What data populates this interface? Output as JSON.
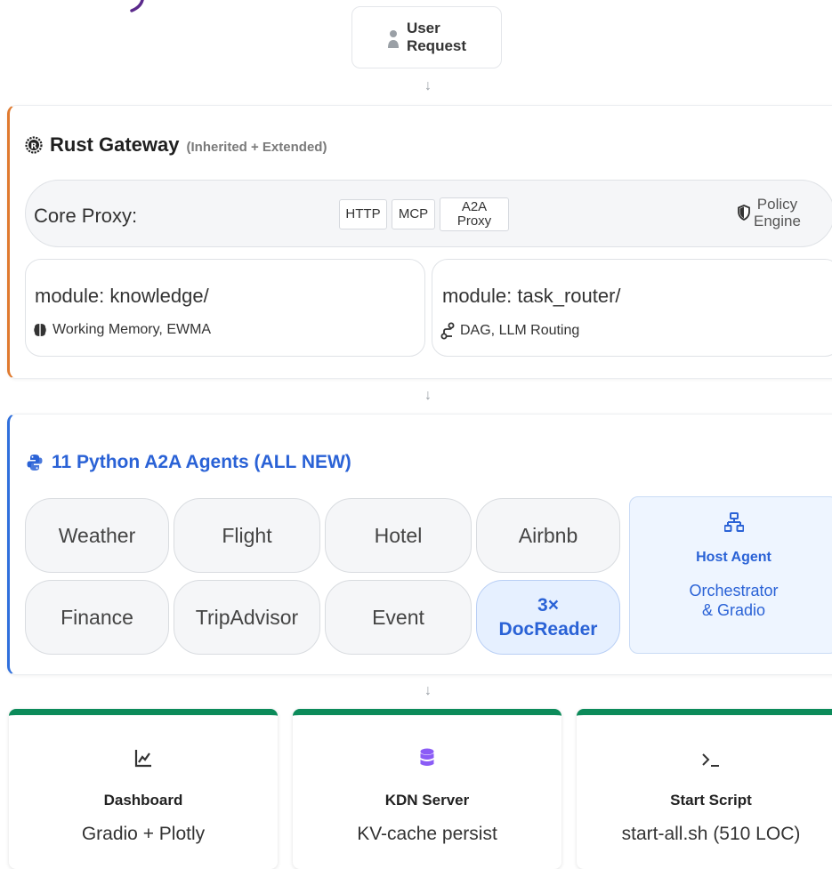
{
  "user": {
    "line1": "User",
    "line2": "Request"
  },
  "arrows": [
    "↓",
    "↓",
    "↓"
  ],
  "gateway": {
    "title": "Rust Gateway",
    "subtitle": "(Inherited + Extended)",
    "core_label": "Core Proxy:",
    "chips": [
      "HTTP",
      "MCP"
    ],
    "a2a_line1": "A2A",
    "a2a_line2": "Proxy",
    "policy_line1": "Policy",
    "policy_line2": "Engine",
    "modules": [
      {
        "title": "module: knowledge/",
        "subtitle": "Working Memory, EWMA"
      },
      {
        "title": "module: task_router/",
        "subtitle": "DAG, LLM Routing"
      }
    ]
  },
  "agents": {
    "title": "11 Python A2A Agents (ALL NEW)",
    "row1": [
      "Weather",
      "Flight",
      "Hotel",
      "Airbnb"
    ],
    "row2": [
      "Finance",
      "TripAdvisor",
      "Event"
    ],
    "doc_line1": "3×",
    "doc_line2": "DocReader",
    "host_title": "Host Agent",
    "host_line1": "Orchestrator",
    "host_line2": "& Gradio"
  },
  "cards": [
    {
      "title": "Dashboard",
      "subtitle": "Gradio + Plotly",
      "icon": "chart-line-icon"
    },
    {
      "title": "KDN Server",
      "subtitle": "KV-cache persist",
      "icon": "database-icon"
    },
    {
      "title": "Start Script",
      "subtitle": "start-all.sh (510 LOC)",
      "icon": "terminal-icon"
    }
  ],
  "colors": {
    "rust_accent": "#e07a2f",
    "python_accent": "#2f6fdc",
    "card_accent": "#0c8b5a",
    "database_icon": "#8b5cf6"
  }
}
